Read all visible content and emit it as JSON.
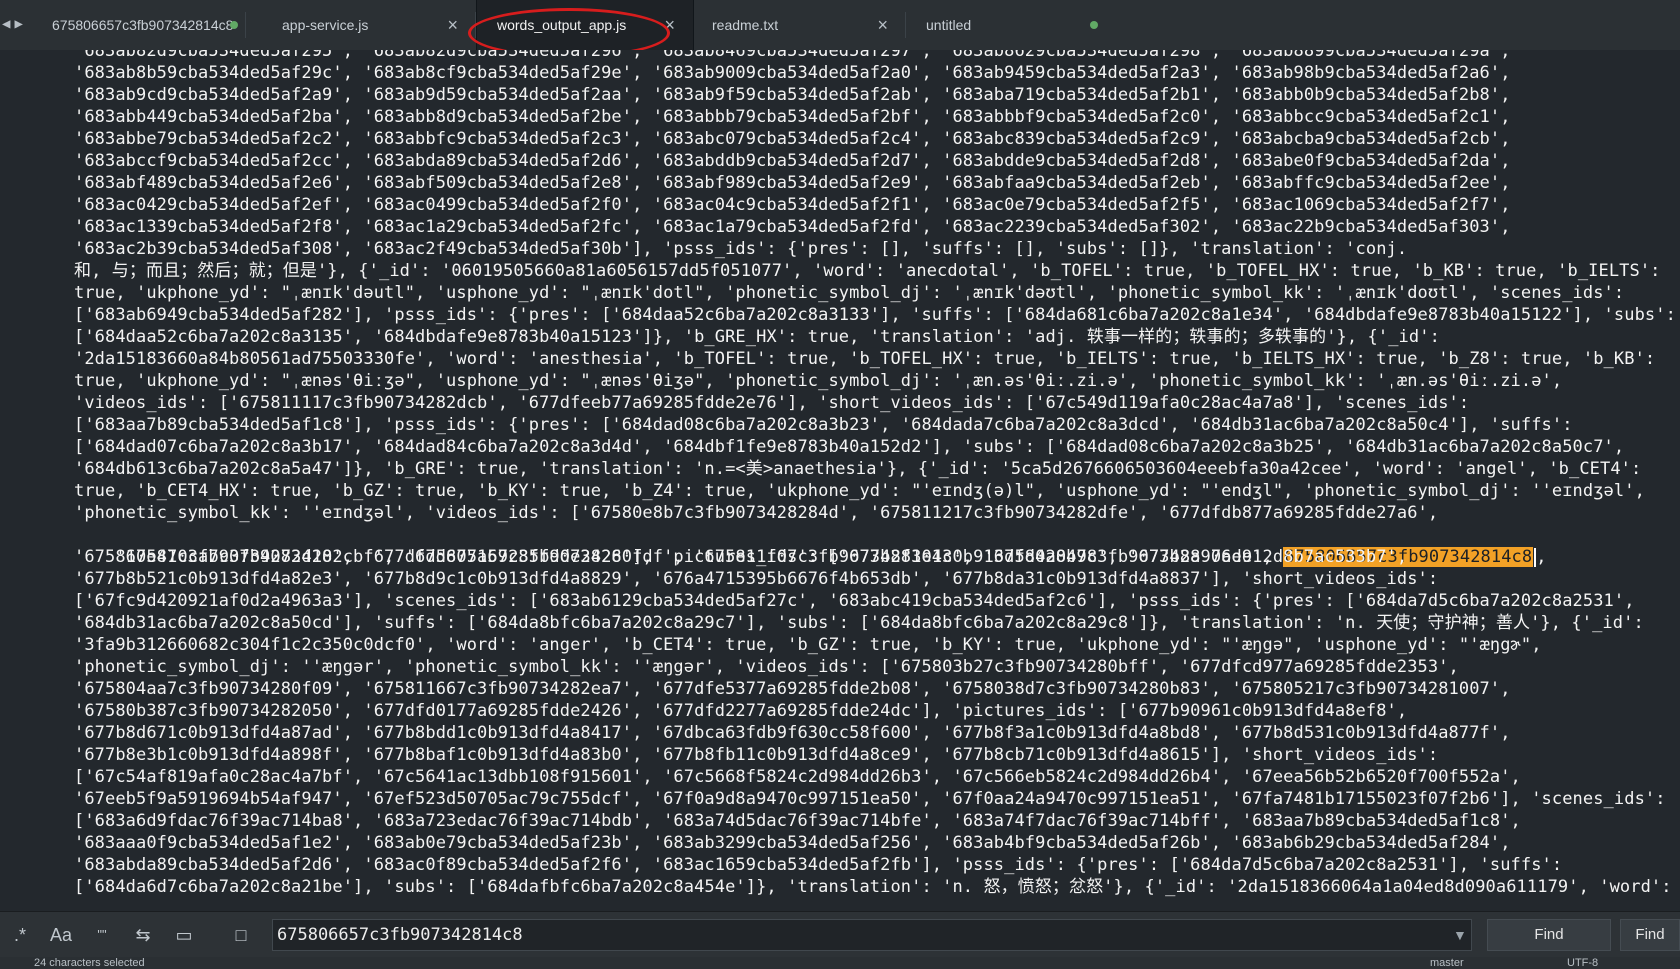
{
  "tabs": [
    {
      "label": "675806657c3fb907342814c8"
    },
    {
      "label": "app-service.js"
    },
    {
      "label": "words_output_app.js"
    },
    {
      "label": "readme.txt"
    },
    {
      "label": "untitled"
    }
  ],
  "editor_lines": [
    "'683ab82d9cba534ded5af295', '683ab82d9cba534ded5af296', '683ab8469cba534ded5af297', '683ab8629cba534ded5af298', '683ab8899cba534ded5af29a',",
    "'683ab8b59cba534ded5af29c', '683ab8cf9cba534ded5af29e', '683ab9009cba534ded5af2a0', '683ab9459cba534ded5af2a3', '683ab98b9cba534ded5af2a6',",
    "'683ab9cd9cba534ded5af2a9', '683ab9d59cba534ded5af2aa', '683ab9f59cba534ded5af2ab', '683aba719cba534ded5af2b1', '683abb0b9cba534ded5af2b8',",
    "'683abb449cba534ded5af2ba', '683abb8d9cba534ded5af2be', '683abbb79cba534ded5af2bf', '683abbbf9cba534ded5af2c0', '683abbcc9cba534ded5af2c1',",
    "'683abbe79cba534ded5af2c2', '683abbfc9cba534ded5af2c3', '683abc079cba534ded5af2c4', '683abc839cba534ded5af2c9', '683abcba9cba534ded5af2cb',",
    "'683abccf9cba534ded5af2cc', '683abda89cba534ded5af2d6', '683abddb9cba534ded5af2d7', '683abdde9cba534ded5af2d8', '683abe0f9cba534ded5af2da',",
    "'683abf489cba534ded5af2e6', '683abf509cba534ded5af2e8', '683abf989cba534ded5af2e9', '683abfaa9cba534ded5af2eb', '683abffc9cba534ded5af2ee',",
    "'683ac0429cba534ded5af2ef', '683ac0499cba534ded5af2f0', '683ac04c9cba534ded5af2f1', '683ac0e79cba534ded5af2f5', '683ac1069cba534ded5af2f7',",
    "'683ac1339cba534ded5af2f8', '683ac1a29cba534ded5af2fc', '683ac1a79cba534ded5af2fd', '683ac2239cba534ded5af302', '683ac22b9cba534ded5af303',",
    "'683ac2b39cba534ded5af308', '683ac2f49cba534ded5af30b'], 'psss_ids': {'pres': [], 'suffs': [], 'subs': []}, 'translation': 'conj.",
    "和, 与；而且；然后；就；但是'}, {'_id': '06019505660a81a6056157dd5f051077', 'word': 'anecdotal', 'b_TOFEL': true, 'b_TOFEL_HX': true, 'b_KB': true, 'b_IELTS':",
    "true, 'ukphone_yd': \"ˌænɪk'dəutl\", 'usphone_yd': \"ˌænɪk'dotl\", 'phonetic_symbol_dj': 'ˌænɪk'dəʊtl', 'phonetic_symbol_kk': 'ˌænɪk'doʊtl', 'scenes_ids':",
    "['683ab6949cba534ded5af282'], 'psss_ids': {'pres': ['684daa52c6ba7a202c8a3133'], 'suffs': ['684da681c6ba7a202c8a1e34', '684dbdafe9e8783b40a15122'], 'subs':",
    "['684daa52c6ba7a202c8a3135', '684dbdafe9e8783b40a15123']}, 'b_GRE_HX': true, 'translation': 'adj. 轶事一样的；轶事的；多轶事的'}, {'_id':",
    "'2da15183660a84b80561ad75503330fe', 'word': 'anesthesia', 'b_TOFEL': true, 'b_TOFEL_HX': true, 'b_IELTS': true, 'b_IELTS_HX': true, 'b_Z8': true, 'b_KB':",
    "true, 'ukphone_yd': \"ˌænəs'θiːʒə\", 'usphone_yd': \"ˌænəs'θiʒə\", 'phonetic_symbol_dj': 'ˌæn.əs'θiː.zi.ə', 'phonetic_symbol_kk': 'ˌæn.əs'θiː.zi.ə',",
    "'videos_ids': ['675811117c3fb90734282dcb', '677dfeeb77a69285fdde2e76'], 'short_videos_ids': ['67c549d119afa0c28ac4a7a8'], 'scenes_ids':",
    "['683aa7b89cba534ded5af1c8'], 'psss_ids': {'pres': ['684dad08c6ba7a202c8a3b23', '684dada7c6ba7a202c8a3dcd', '684db31ac6ba7a202c8a50c4'], 'suffs':",
    "['684dad07c6ba7a202c8a3b17', '684dad84c6ba7a202c8a3d4d', '684dbf1fe9e8783b40a152d2'], 'subs': ['684dad08c6ba7a202c8a3b25', '684db31ac6ba7a202c8a50c7',",
    "'684db613c6ba7a202c8a5a47']}, 'b_GRE': true, 'translation': 'n.=<美>anaethesia'}, {'_id': '5ca5d2676606503604eeebfa30a42cee', 'word': 'angel', 'b_CET4':",
    "true, 'b_CET4_HX': true, 'b_GZ': true, 'b_KY': true, 'b_Z4': true, 'ukphone_yd': \"'eɪndʒ(ə)l\", 'usphone_yd': \"'endʒl\", 'phonetic_symbol_dj': ''eɪndʒəl',",
    "'phonetic_symbol_kk': ''eɪndʒəl', 'videos_ids': ['67580e8b7c3fb9073428284d', '675811217c3fb90734282dfe', '677dfdb877a69285fdde27a6',",
    "'675810ca7c3fb90734282cbf', '675805157c3fb90734280fdf', '675811f07c3fb90734283043', '675802047c3fb9073428 06de', ",
    "'675810e47c3fb90734282d10', '677dfdd677a69285fdde2826'], 'pictures_ids': ['677b8f1e1c0b913dfd4a8b98', '677b8a97ae912d8b7ac533b7',",
    "'677b8b521c0b913dfd4a82e3', '677b8d9c1c0b913dfd4a8829', '676a4715395b6676f4b653db', '677b8da31c0b913dfd4a8837'], 'short_videos_ids':",
    "['67fc9d420921af0d2a4963a3'], 'scenes_ids': ['683ab6129cba534ded5af27c', '683abc419cba534ded5af2c6'], 'psss_ids': {'pres': ['684da7d5c6ba7a202c8a2531',",
    "'684db31ac6ba7a202c8a50cd'], 'suffs': ['684da8bfc6ba7a202c8a29c7'], 'subs': ['684da8bfc6ba7a202c8a29c8']}, 'translation': 'n. 天使；守护神；善人'}, {'_id':",
    "'3fa9b312660682c304f1c2c350c0dcf0', 'word': 'anger', 'b_CET4': true, 'b_GZ': true, 'b_KY': true, 'ukphone_yd': \"'æŋgə\", 'usphone_yd': \"'æŋgɚ\",",
    "'phonetic_symbol_dj': ''æŋgər', 'phonetic_symbol_kk': ''æŋgər', 'videos_ids': ['675803b27c3fb90734280bff', '677dfcd977a69285fdde2353',",
    "'675804aa7c3fb90734280f09', '675811667c3fb90734282ea7', '677dfe5377a69285fdde2b08', '6758038d7c3fb90734280b83', '675805217c3fb90734281007',",
    "'67580b387c3fb90734282050', '677dfd0177a69285fdde2426', '677dfd2277a69285fdde24dc'], 'pictures_ids': ['677b90961c0b913dfd4a8ef8',",
    "'677b8d671c0b913dfd4a87ad', '677b8bdd1c0b913dfd4a8417', '67dbca63fdb9f630cc58f600', '677b8f3a1c0b913dfd4a8bd8', '677b8d531c0b913dfd4a877f',",
    "'677b8e3b1c0b913dfd4a898f', '677b8baf1c0b913dfd4a83b0', '677b8fb11c0b913dfd4a8ce9', '677b8cb71c0b913dfd4a8615'], 'short_videos_ids':",
    "['67c54af819afa0c28ac4a7bf', '67c5641ac13dbb108f915601', '67c5668f5824c2d984dd26b3', '67c566eb5824c2d984dd26b4', '67eea56b52b6520f700f552a',",
    "'67eeb5f9a5919694b54af947', '67ef523d50705ac79c755dcf', '67f0a9d8a9470c997151ea50', '67f0aa24a9470c997151ea51', '67fa7481b17155023f07f2b6'], 'scenes_ids':",
    "['683a6d9fdac76f39ac714ba8', '683a723edac76f39ac714bdb', '683a74d5dac76f39ac714bfe', '683a74f7dac76f39ac714bff', '683aa7b89cba534ded5af1c8',",
    "'683aaa0f9cba534ded5af1e2', '683ab0e79cba534ded5af23b', '683ab3299cba534ded5af256', '683ab4bf9cba534ded5af26b', '683ab6b29cba534ded5af284',",
    "'683abda89cba534ded5af2d6', '683ac0f89cba534ded5af2f6', '683ac1659cba534ded5af2fb'], 'psss_ids': {'pres': ['684da7d5c6ba7a202c8a2531'], 'suffs':",
    "['684da6d7c6ba7a202c8a21be'], 'subs': ['684dafbfc6ba7a202c8a454e']}, 'translation': 'n. 怒，愤怒；忿怒'}, {'_id': '2da1518366064a1a04ed8d090a611179', 'word':"
  ],
  "highlight_text": "675806657c3fb907342814c8",
  "highlight_suffix": ",",
  "find": {
    "regex_label": ".*",
    "case_label": "Aa",
    "word_label": "\"\"",
    "query": "675806657c3fb907342814c8",
    "find_label": "Find",
    "find_all_label": "Find"
  },
  "status": {
    "selection": "24 characters selected",
    "branch": "master",
    "encoding": "UTF-8"
  },
  "colors": {
    "accent_highlight": "#f2a126",
    "annotation_circle": "#d71d1d",
    "dirty_dot": "#61a965"
  }
}
